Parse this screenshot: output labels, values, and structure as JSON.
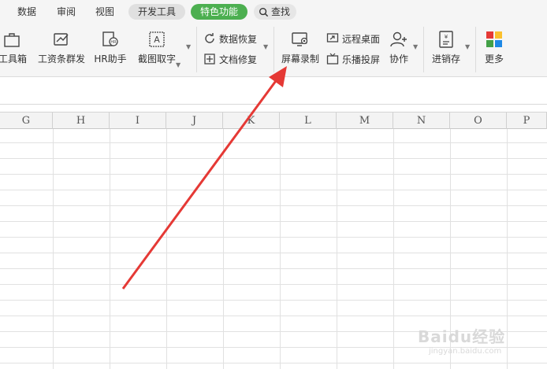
{
  "menu": {
    "tabs": [
      {
        "label": "数据"
      },
      {
        "label": "审阅"
      },
      {
        "label": "视图"
      },
      {
        "label": "开发工具"
      },
      {
        "label": "特色功能"
      }
    ],
    "search_label": "查找"
  },
  "ribbon": {
    "toolbox": "工具箱",
    "payroll": "工资条群发",
    "hr": "HR助手",
    "screenshot": "截图取字",
    "data_recovery": "数据恢复",
    "doc_repair": "文档修复",
    "screen_record": "屏幕录制",
    "remote_desktop": "远程桌面",
    "cast": "乐播投屏",
    "collab": "协作",
    "inventory": "进销存",
    "more": "更多"
  },
  "grid": {
    "columns": [
      "G",
      "H",
      "I",
      "J",
      "K",
      "L",
      "M",
      "N",
      "O",
      "P"
    ]
  },
  "watermark": {
    "main": "Baidu经验",
    "sub": "jingyan.baidu.com"
  },
  "colors": {
    "active_tab": "#4caf50",
    "arrow": "#e53935"
  }
}
